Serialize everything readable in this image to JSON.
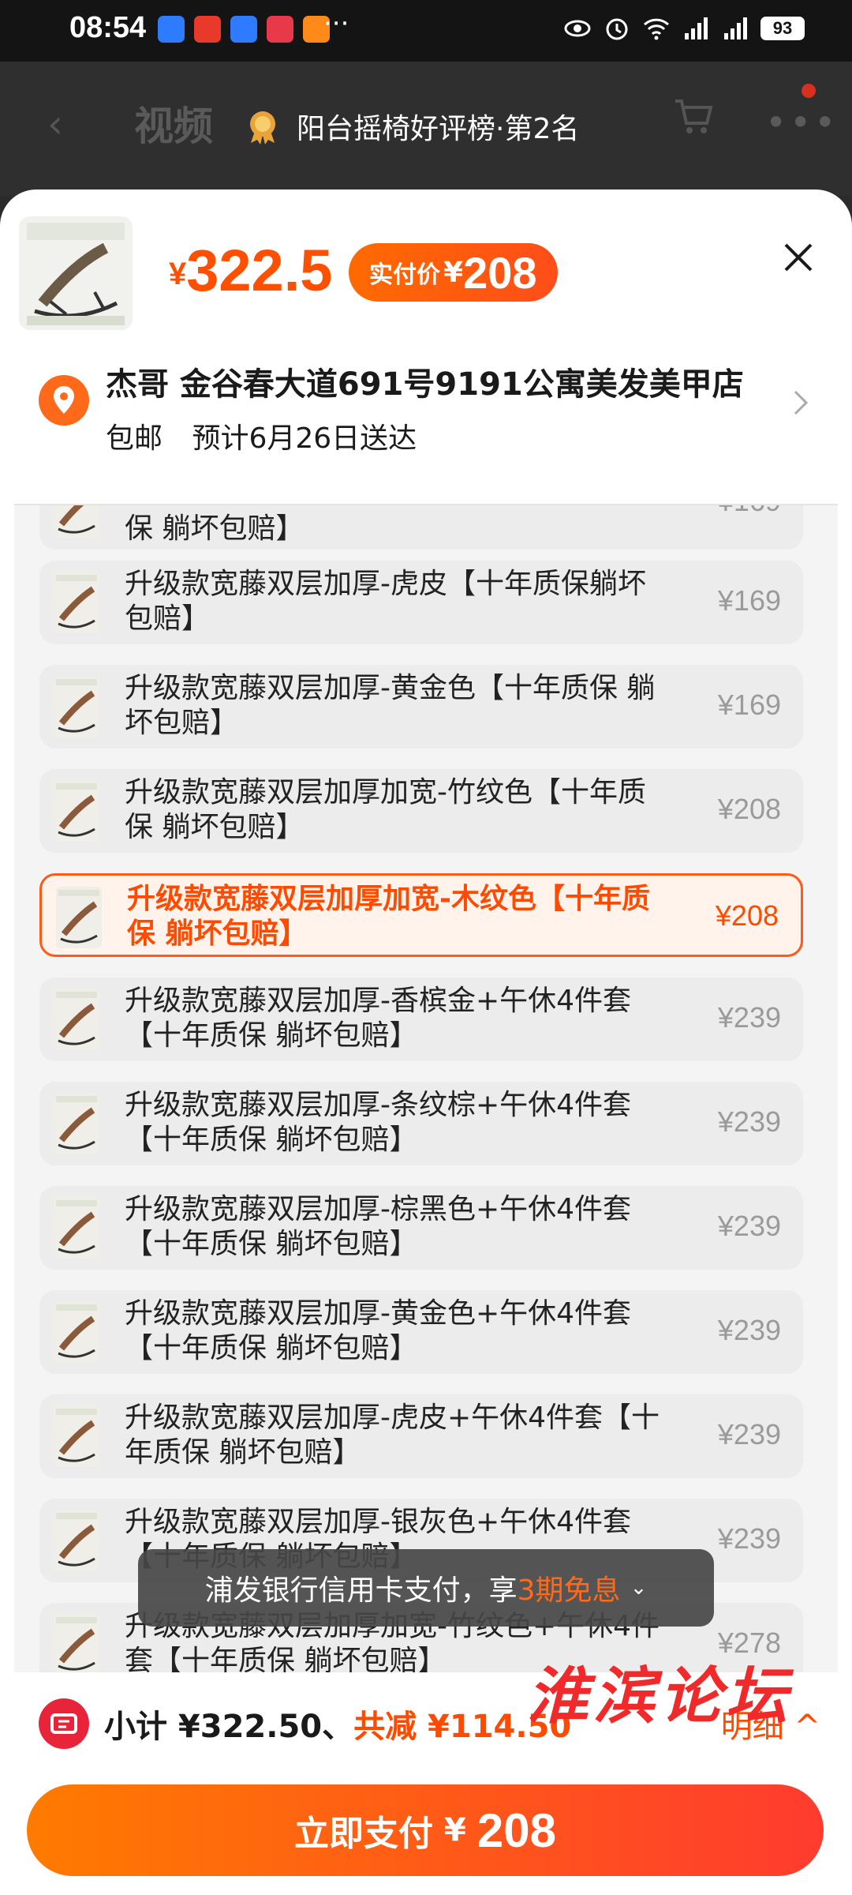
{
  "status_bar": {
    "time": "08:54",
    "battery": "93",
    "app_icon_colors": [
      "#2f7bff",
      "#e8392b",
      "#2f7bff",
      "#e8394a",
      "#ff8a1a"
    ],
    "more": "···"
  },
  "background_header": {
    "tab_label": "视频",
    "rank_badge": "阳台摇椅好评榜·第2名"
  },
  "product": {
    "currency": "¥",
    "price": "322.5",
    "actual_label": "实付价",
    "actual_currency": "¥",
    "actual_price": "208"
  },
  "address": {
    "recipient_line": "杰哥 金谷春大道691号9191公寓美发美甲店",
    "shipping": "包邮",
    "delivery": "预计6月26日送达"
  },
  "skus": [
    {
      "name": "保 躺坏包赔】",
      "price": "¥169"
    },
    {
      "name": "升级款宽藤双层加厚-虎皮【十年质保躺坏包赔】",
      "price": "¥169"
    },
    {
      "name": "升级款宽藤双层加厚-黄金色【十年质保 躺坏包赔】",
      "price": "¥169"
    },
    {
      "name": "升级款宽藤双层加厚加宽-竹纹色【十年质保 躺坏包赔】",
      "price": "¥208"
    },
    {
      "name": "升级款宽藤双层加厚加宽-木纹色【十年质保 躺坏包赔】",
      "price": "¥208",
      "selected": true
    },
    {
      "name": "升级款宽藤双层加厚-香槟金+午休4件套【十年质保 躺坏包赔】",
      "price": "¥239"
    },
    {
      "name": "升级款宽藤双层加厚-条纹棕+午休4件套【十年质保 躺坏包赔】",
      "price": "¥239"
    },
    {
      "name": "升级款宽藤双层加厚-棕黑色+午休4件套【十年质保 躺坏包赔】",
      "price": "¥239"
    },
    {
      "name": "升级款宽藤双层加厚-黄金色+午休4件套【十年质保 躺坏包赔】",
      "price": "¥239"
    },
    {
      "name": "升级款宽藤双层加厚-虎皮+午休4件套【十年质保 躺坏包赔】",
      "price": "¥239"
    },
    {
      "name": "升级款宽藤双层加厚-银灰色+午休4件套【十年质保 躺坏包赔】",
      "price": "¥239"
    },
    {
      "name": "升级款宽藤双层加厚加宽-竹纹色+午休4件套【十年质保 躺坏包赔】",
      "price": "¥278"
    }
  ],
  "toast": {
    "text_before": "浦发银行信用卡支付，享",
    "highlight": "3期免息",
    "chevron": "⌄"
  },
  "footer": {
    "subtotal_label": "小计 ¥322.50、",
    "discount_label": "共减 ¥114.50",
    "detail_link": "明细 ^",
    "pay_label": "立即支付",
    "pay_currency": "¥",
    "pay_amount": "208"
  },
  "watermark": "淮滨论坛",
  "colors": {
    "accent": "#ff4f00",
    "selected_border": "#ff5a1a",
    "watermark": "#f02a2a"
  }
}
